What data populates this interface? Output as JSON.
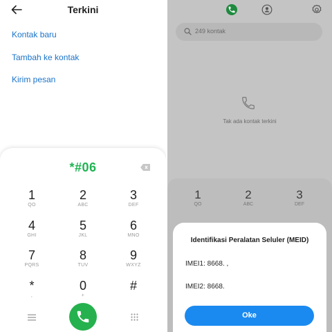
{
  "left": {
    "header": {
      "title": "Terkini",
      "back_icon": "arrow-left-icon"
    },
    "menu": [
      "Kontak baru",
      "Tambah ke kontak",
      "Kirim pesan"
    ],
    "dialed_number": "*#06",
    "keys": [
      {
        "digit": "1",
        "letters": "QO"
      },
      {
        "digit": "2",
        "letters": "ABC"
      },
      {
        "digit": "3",
        "letters": "DEF"
      },
      {
        "digit": "4",
        "letters": "GHI"
      },
      {
        "digit": "5",
        "letters": "JKL"
      },
      {
        "digit": "6",
        "letters": "MNO"
      },
      {
        "digit": "7",
        "letters": "PQRS"
      },
      {
        "digit": "8",
        "letters": "TUV"
      },
      {
        "digit": "9",
        "letters": "WXYZ"
      },
      {
        "digit": "*",
        "letters": ","
      },
      {
        "digit": "0",
        "letters": "+"
      },
      {
        "digit": "#",
        "letters": ""
      }
    ],
    "call_color": "#25b14d"
  },
  "right": {
    "search_placeholder": "249 kontak",
    "empty_text": "Tak ada kontak terkini",
    "keys": [
      {
        "digit": "1",
        "letters": "QO"
      },
      {
        "digit": "2",
        "letters": "ABC"
      },
      {
        "digit": "3",
        "letters": "DEF"
      }
    ],
    "dialog": {
      "title": "Identifikasi Peralatan Seluler (MEID)",
      "imei1": "IMEI1: 8668. ,",
      "imei2": "IMEI2: 8668.",
      "ok_label": "Oke"
    },
    "accent": "#1a8af0"
  }
}
